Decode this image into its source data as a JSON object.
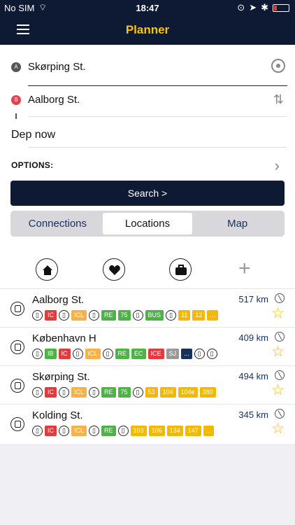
{
  "status": {
    "carrier": "No SIM",
    "time": "18:47"
  },
  "header": {
    "title": "Planner"
  },
  "planner": {
    "from": "Skørping St.",
    "to": "Aalborg St.",
    "from_marker": "A",
    "to_marker": "B",
    "departure": "Dep now",
    "options_label": "OPTIONS:",
    "search_label": "Search >"
  },
  "tabs": [
    {
      "label": "Connections"
    },
    {
      "label": "Locations"
    },
    {
      "label": "Map"
    }
  ],
  "quick_actions": [
    "home-icon",
    "heart-icon",
    "briefcase-icon",
    "plus-icon"
  ],
  "locations": [
    {
      "name": "Aalborg St.",
      "distance": "517 km",
      "tags": [
        {
          "text": "IC",
          "type": "red"
        },
        {
          "text": "ICL",
          "type": "orange"
        },
        {
          "text": "RE",
          "type": "green"
        },
        {
          "text": "75",
          "type": "green"
        },
        {
          "text": "BUS",
          "type": "bus"
        },
        {
          "text": "11",
          "type": "yellow"
        },
        {
          "text": "12",
          "type": "yellow"
        },
        {
          "text": "...",
          "type": "yellow"
        }
      ]
    },
    {
      "name": "København H",
      "distance": "409 km",
      "tags": [
        {
          "text": "IB",
          "type": "green"
        },
        {
          "text": "IC",
          "type": "red"
        },
        {
          "text": "ICL",
          "type": "orange"
        },
        {
          "text": "RE",
          "type": "green"
        },
        {
          "text": "EC",
          "type": "green"
        },
        {
          "text": "ICE",
          "type": "red"
        },
        {
          "text": "SJ",
          "type": "grey"
        },
        {
          "text": "...",
          "type": "blue"
        }
      ]
    },
    {
      "name": "Skørping St.",
      "distance": "494 km",
      "tags": [
        {
          "text": "IC",
          "type": "red"
        },
        {
          "text": "ICL",
          "type": "orange"
        },
        {
          "text": "RE",
          "type": "green"
        },
        {
          "text": "75",
          "type": "green"
        },
        {
          "text": "53",
          "type": "yellow"
        },
        {
          "text": "104",
          "type": "yellow"
        },
        {
          "text": "104e",
          "type": "yellow"
        },
        {
          "text": "380",
          "type": "yellow"
        }
      ]
    },
    {
      "name": "Kolding St.",
      "distance": "345 km",
      "tags": [
        {
          "text": "IC",
          "type": "red"
        },
        {
          "text": "ICL",
          "type": "orange"
        },
        {
          "text": "RE",
          "type": "green"
        },
        {
          "text": "103",
          "type": "yellow"
        },
        {
          "text": "106",
          "type": "yellow"
        },
        {
          "text": "134",
          "type": "yellow"
        },
        {
          "text": "147",
          "type": "yellow"
        },
        {
          "text": "...",
          "type": "yellow"
        }
      ]
    }
  ]
}
